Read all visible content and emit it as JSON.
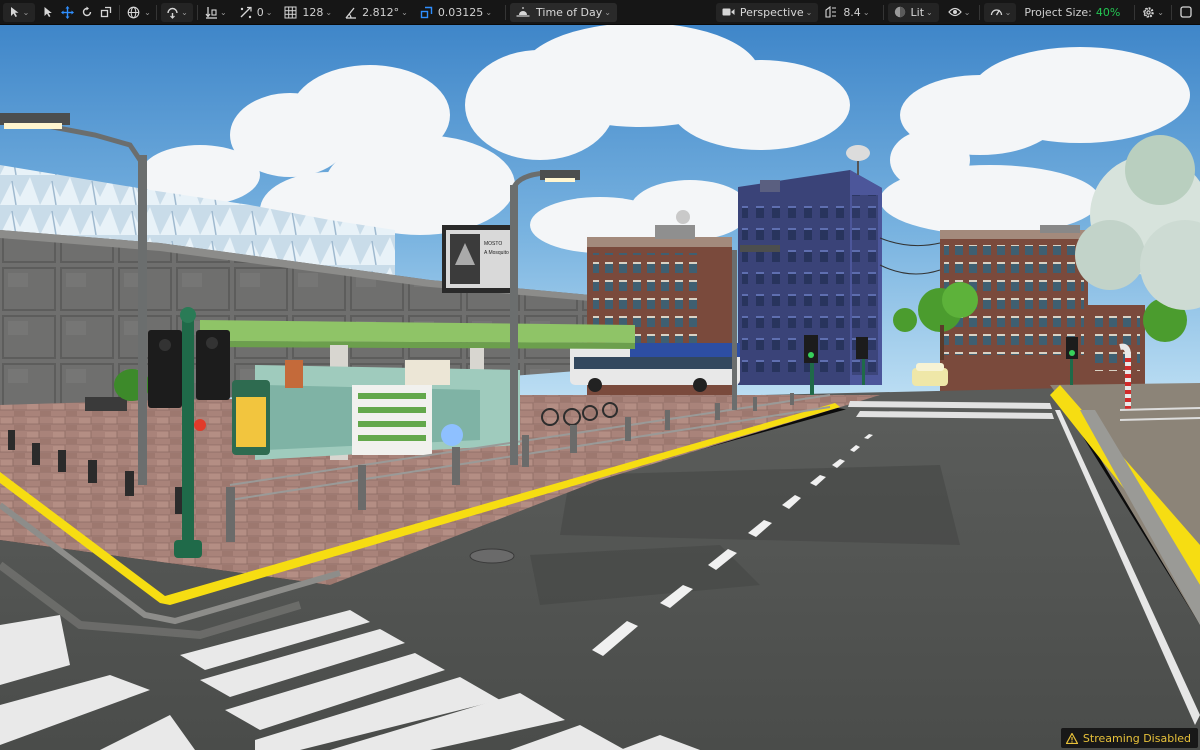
{
  "toolbar": {
    "snap_count": "0",
    "grid_size": "128",
    "angle_value": "2.812°",
    "scale_value": "0.03125",
    "time_of_day_label": "Time of Day",
    "perspective_label": "Perspective",
    "camera_speed": "8.4",
    "lit_label": "Lit",
    "project_size_label": "Project Size:",
    "project_size_value": "40%"
  },
  "billboard": {
    "heading": "MOSTO",
    "subheading": "A Mosquito"
  },
  "status": {
    "streaming_label": "Streaming Disabled"
  },
  "colors": {
    "toolbar_bg": "#161616",
    "accent_blue": "#2f8fff",
    "project_size_green": "#23c552",
    "warning_yellow": "#e7c13a",
    "road_marking_yellow": "#f6dd12"
  }
}
